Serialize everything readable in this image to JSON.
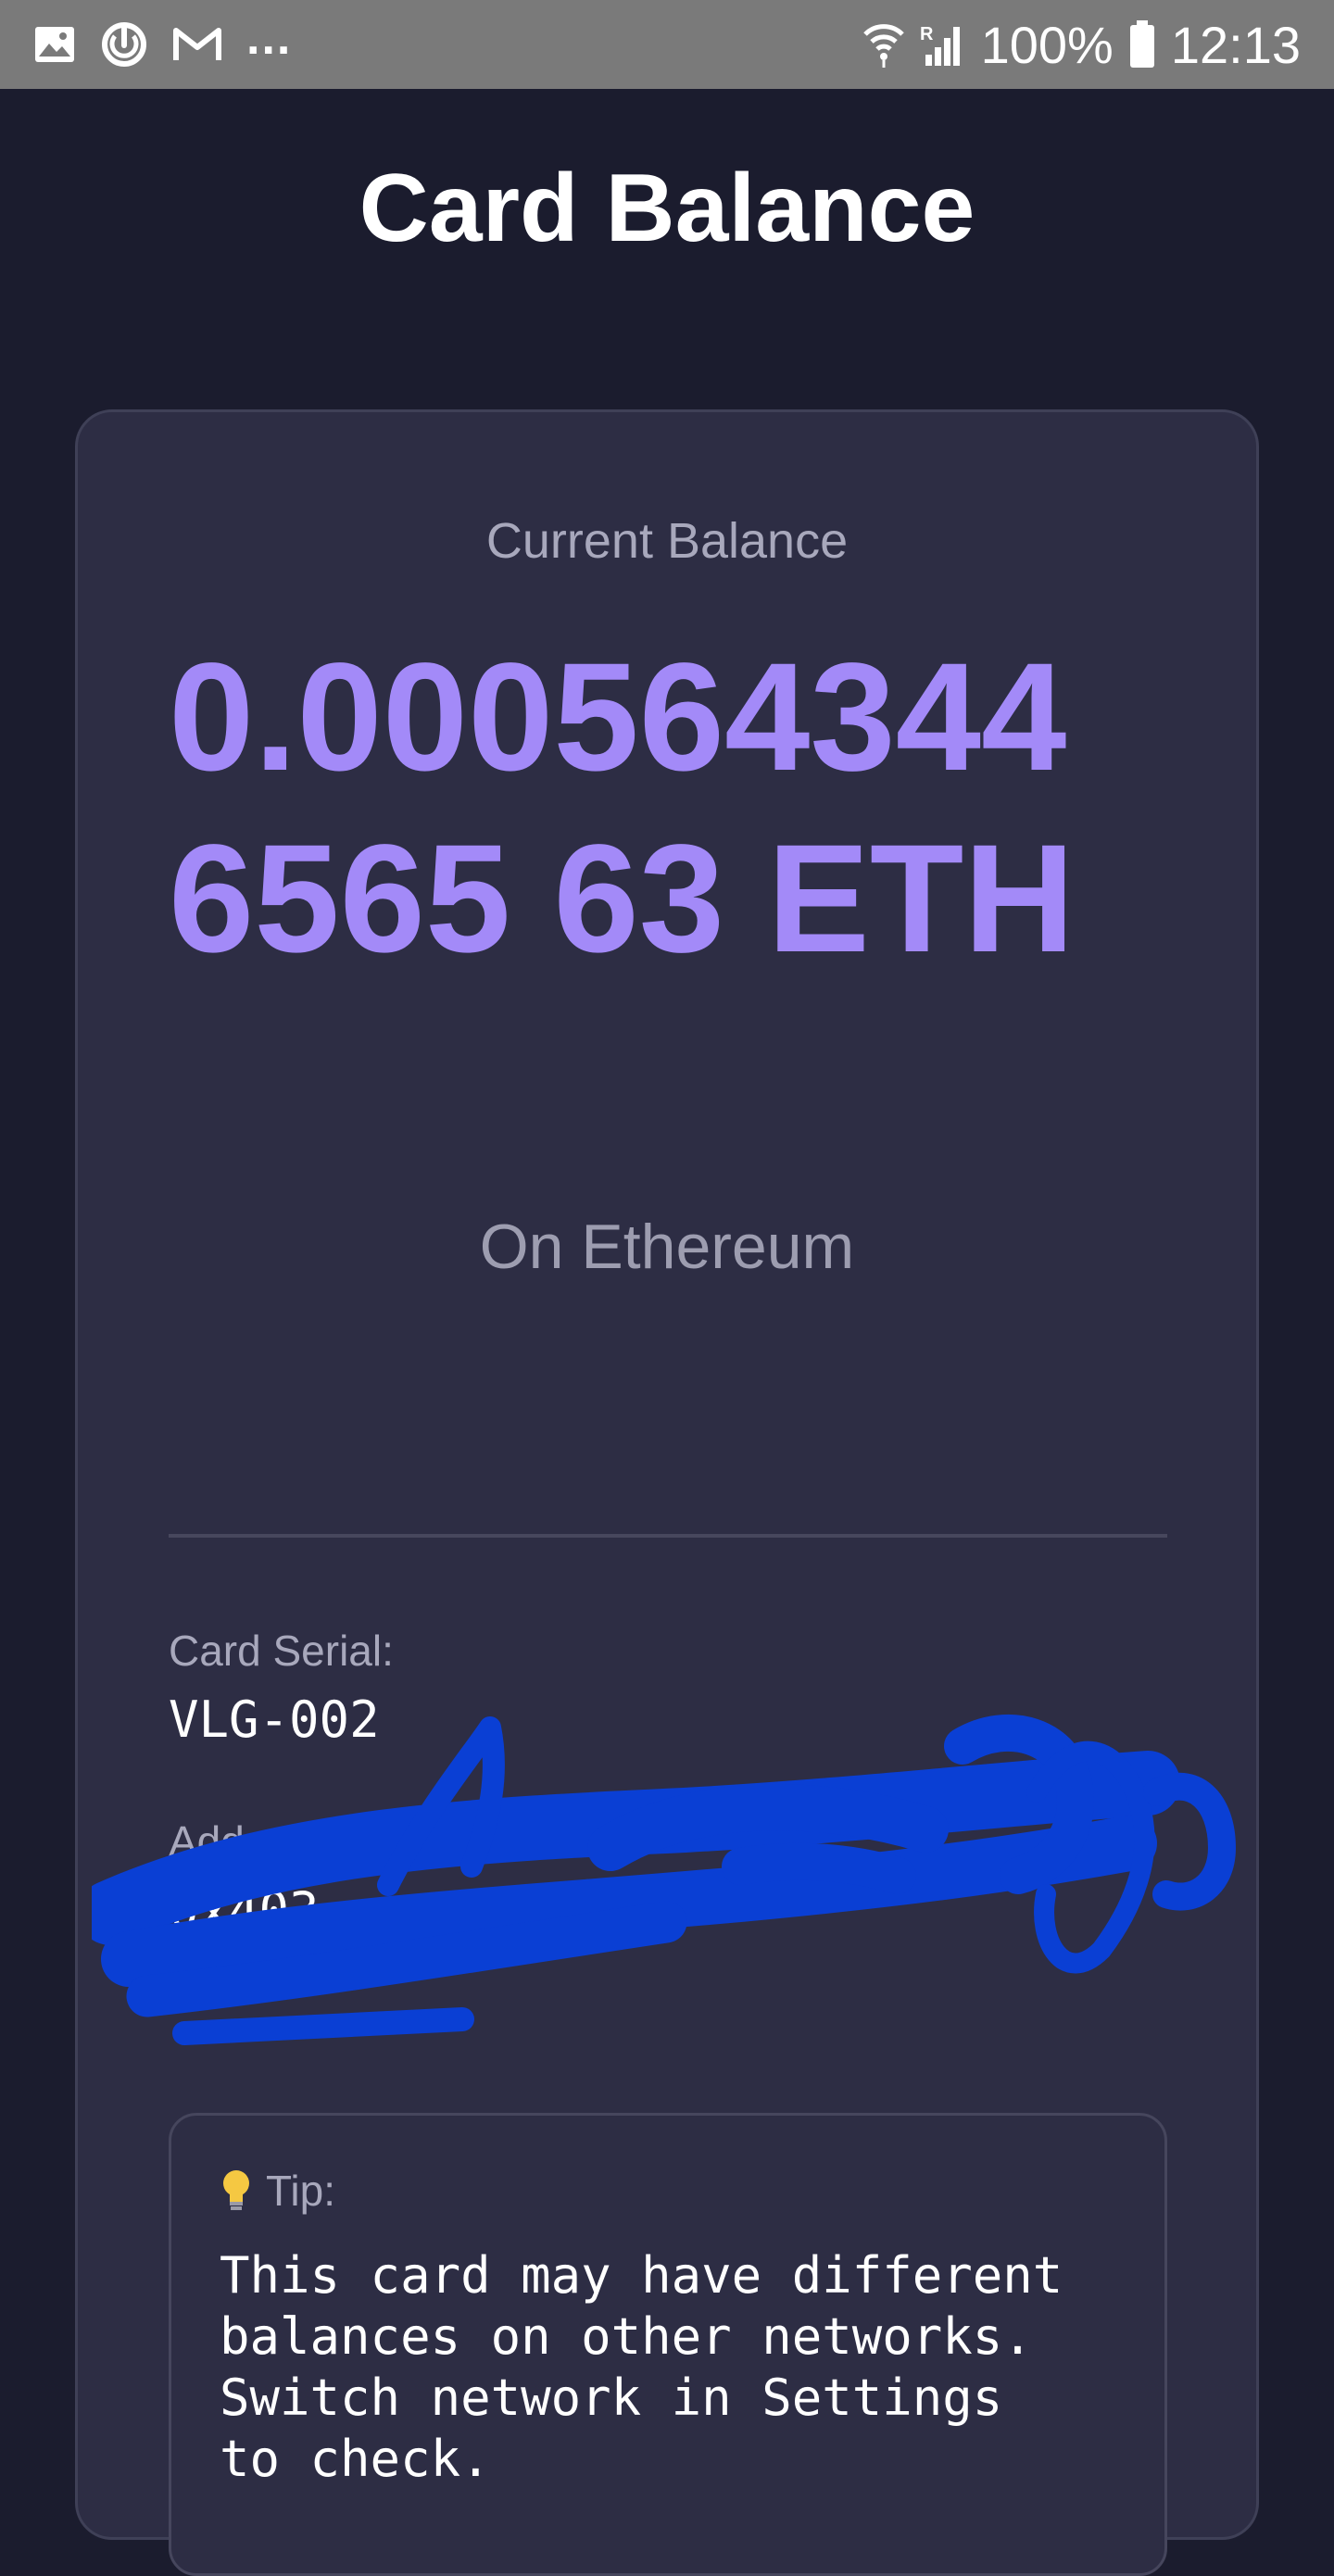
{
  "status_bar": {
    "left_icons": [
      "gallery-icon",
      "sync-icon",
      "gmail-icon"
    ],
    "overflow": "...",
    "right_icons": [
      "wifi-icon",
      "signal-icon",
      "battery-icon"
    ],
    "roaming": "R",
    "battery": "100%",
    "time": "12:13"
  },
  "header": {
    "title": "Card Balance"
  },
  "balance": {
    "label": "Current Balance",
    "value": "0.0005643446565 63 ETH",
    "network": "On Ethereum"
  },
  "card_info": {
    "serial_label": "Card Serial:",
    "serial_value": "VLG-002",
    "address_label": "Address:",
    "address_value": "0x403"
  },
  "tip": {
    "icon": "lightbulb-icon",
    "label": "Tip:",
    "text": "This card may have different\nbalances on other networks.\nSwitch network in Settings\nto check."
  },
  "colors": {
    "background": "#1b1c2e",
    "card": "#2d2d44",
    "accent": "#a38af8",
    "redaction": "#0a3fd4",
    "status_bar": "#7a7a7a"
  }
}
